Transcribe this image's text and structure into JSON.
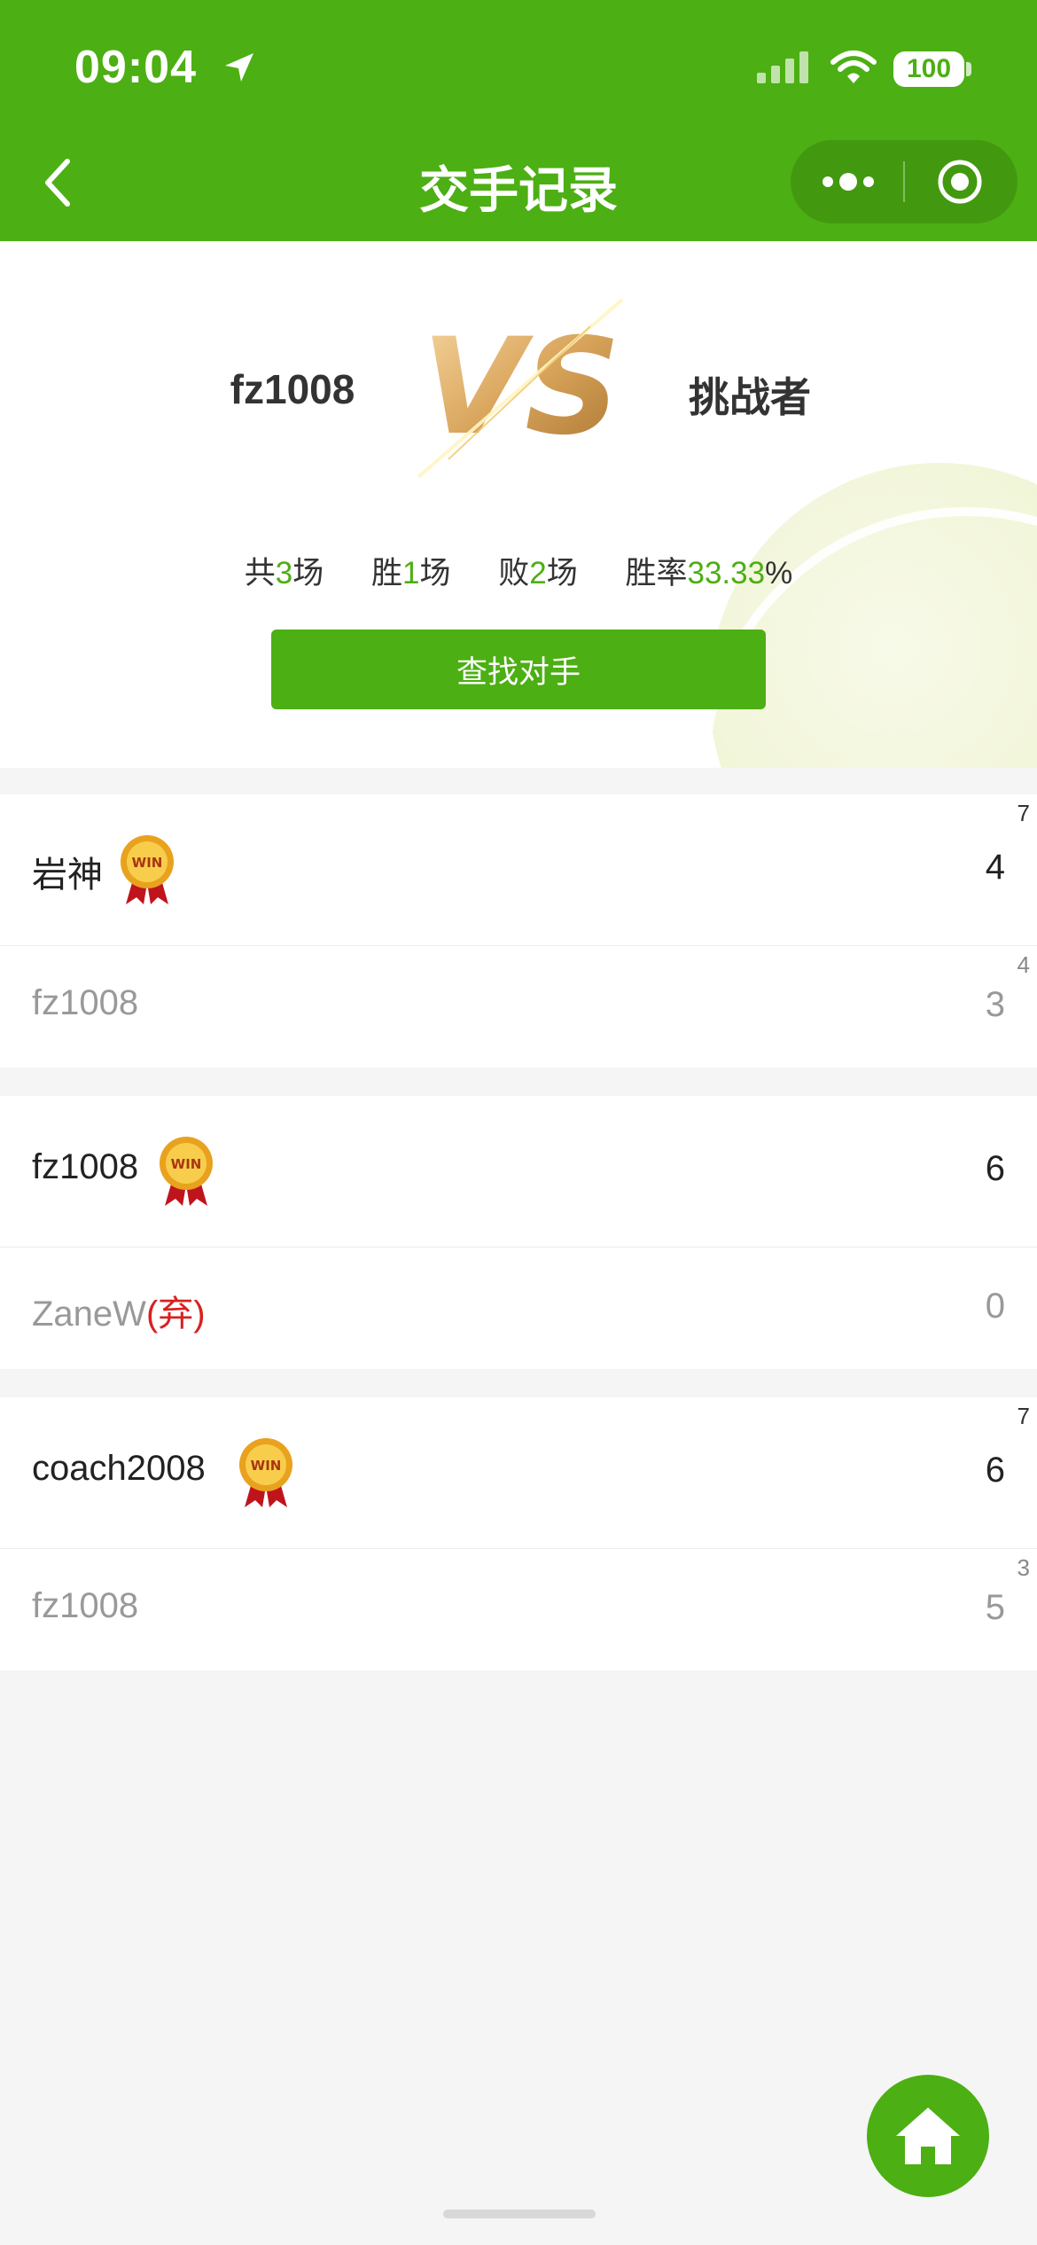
{
  "status_bar": {
    "time": "09:04",
    "battery": "100"
  },
  "header": {
    "title": "交手记录"
  },
  "hero": {
    "player_left": "fz1008",
    "player_right": "挑战者",
    "vs_text": "VS",
    "stats": {
      "total_prefix": "共",
      "total": "3",
      "total_suffix": "场",
      "wins_prefix": "胜",
      "wins": "1",
      "wins_suffix": "场",
      "losses_prefix": "败",
      "losses": "2",
      "losses_suffix": "场",
      "rate_prefix": "胜率",
      "rate": "33.33",
      "rate_suffix": "%"
    },
    "find_button": "查找对手"
  },
  "medal_text": "WIN",
  "matches": [
    {
      "winner": {
        "name": "岩神",
        "score": "4",
        "tiebreak": "7"
      },
      "loser": {
        "name": "fz1008",
        "forfeit": "",
        "score": "3",
        "tiebreak": "4"
      }
    },
    {
      "winner": {
        "name": "fz1008",
        "score": "6",
        "tiebreak": ""
      },
      "loser": {
        "name": "ZaneW",
        "forfeit": "(弃)",
        "score": "0",
        "tiebreak": ""
      }
    },
    {
      "winner": {
        "name": "coach2008",
        "score": "6",
        "tiebreak": "7"
      },
      "loser": {
        "name": "fz1008",
        "forfeit": "",
        "score": "5",
        "tiebreak": "3"
      }
    }
  ],
  "colors": {
    "brand_green": "#4caf13",
    "forfeit_red": "#d62222"
  },
  "icons": {
    "back": "chevron-left-icon",
    "more": "more-dots-icon",
    "close": "target-circle-icon",
    "home": "home-icon"
  }
}
